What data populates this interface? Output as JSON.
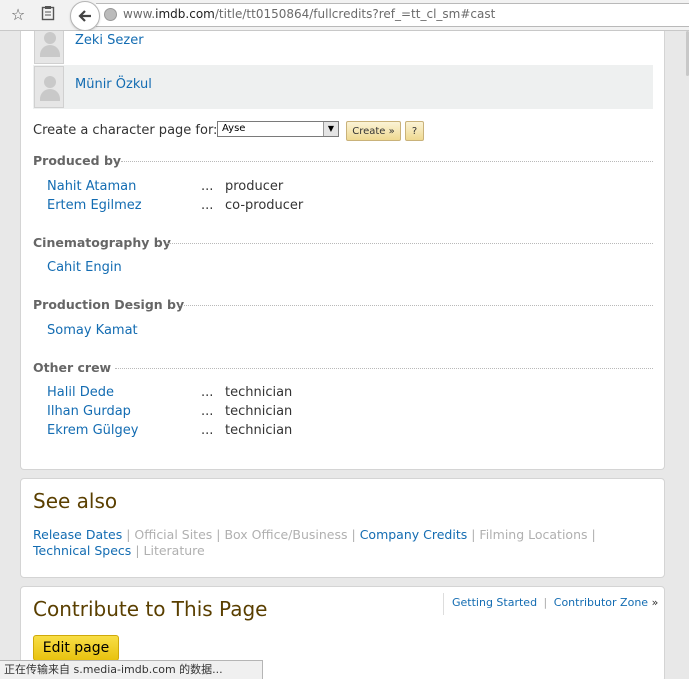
{
  "browser": {
    "url_prefix": "www.",
    "url_host": "imdb.com",
    "url_path": "/title/tt0150864/fullcredits?ref_=tt_cl_sm#cast",
    "status_text": "正在传输来自 s.media-imdb.com 的数据..."
  },
  "cast": [
    {
      "name": "Zeki Sezer"
    },
    {
      "name": "Münir Özkul"
    }
  ],
  "character_page": {
    "label": "Create a character page for:",
    "selected": "Ayse",
    "create_label": "Create »",
    "help_label": "?"
  },
  "sections": {
    "produced": {
      "title": "Produced by",
      "rows": [
        {
          "name": "Nahit Ataman",
          "dots": "...",
          "role": "producer"
        },
        {
          "name": "Ertem Egilmez",
          "dots": "...",
          "role": "co-producer"
        }
      ]
    },
    "cinematography": {
      "title": "Cinematography by",
      "rows": [
        {
          "name": "Cahit Engin"
        }
      ]
    },
    "design": {
      "title": "Production Design by",
      "rows": [
        {
          "name": "Somay Kamat"
        }
      ]
    },
    "other": {
      "title": "Other crew",
      "rows": [
        {
          "name": "Halil Dede",
          "dots": "...",
          "role": "technician"
        },
        {
          "name": "Ilhan Gurdap",
          "dots": "...",
          "role": "technician"
        },
        {
          "name": "Ekrem Gülgey",
          "dots": "...",
          "role": "technician"
        }
      ]
    }
  },
  "see_also": {
    "title": "See also",
    "links": [
      {
        "label": "Release Dates",
        "enabled": true
      },
      {
        "label": "Official Sites",
        "enabled": false
      },
      {
        "label": "Box Office/Business",
        "enabled": false
      },
      {
        "label": "Company Credits",
        "enabled": true
      },
      {
        "label": "Filming Locations",
        "enabled": false
      },
      {
        "label": "Technical Specs",
        "enabled": true
      },
      {
        "label": "Literature",
        "enabled": false
      }
    ]
  },
  "contribute": {
    "title": "Contribute to This Page",
    "getting_started": "Getting Started",
    "separator": "|",
    "contributor_zone": "Contributor Zone",
    "arrow": "»",
    "edit_label": "Edit page"
  },
  "colors": {
    "link": "#136cb2",
    "heading_brown": "#5a3f00",
    "edit_button": "#f5d229"
  }
}
